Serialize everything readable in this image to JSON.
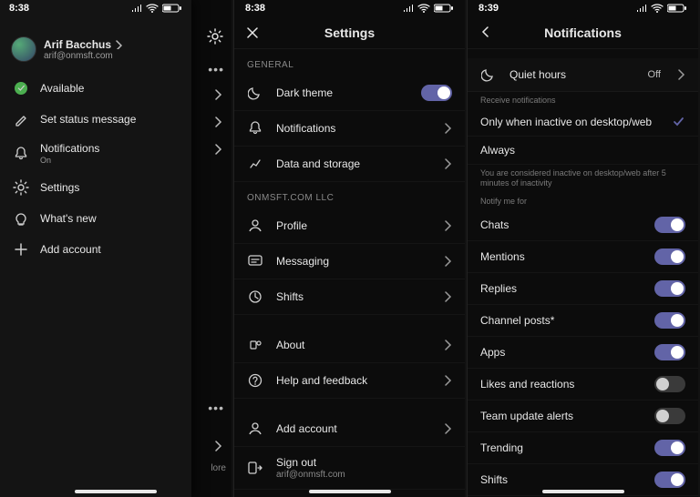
{
  "screen1": {
    "time": "8:38",
    "profile": {
      "name": "Arif Bacchus",
      "email": "arif@onmsft.com"
    },
    "presence": {
      "label": "Available"
    },
    "items": {
      "status": {
        "label": "Set status message"
      },
      "notifications": {
        "label": "Notifications",
        "sub": "On"
      },
      "settings": {
        "label": "Settings"
      },
      "whatsnew": {
        "label": "What's new"
      },
      "add": {
        "label": "Add account"
      }
    },
    "behind_more": "lore"
  },
  "screen2": {
    "time": "8:38",
    "title": "Settings",
    "sections": {
      "general": "GENERAL",
      "org": "ONMSFT.COM LLC"
    },
    "rows": {
      "dark": "Dark theme",
      "notifications": "Notifications",
      "data": "Data and storage",
      "profile": "Profile",
      "messaging": "Messaging",
      "shifts": "Shifts",
      "about": "About",
      "help": "Help and feedback",
      "add": "Add account",
      "signout": {
        "label": "Sign out",
        "sub": "arif@onmsft.com"
      }
    }
  },
  "screen3": {
    "time": "8:39",
    "title": "Notifications",
    "quiet": {
      "label": "Quiet hours",
      "value": "Off"
    },
    "receive_label": "Receive notifications",
    "options": {
      "inactive": "Only when inactive on desktop/web",
      "always": "Always"
    },
    "hint": "You are considered inactive on desktop/web after 5 minutes of inactivity",
    "notify_label": "Notify me for",
    "toggles": {
      "chats": "Chats",
      "mentions": "Mentions",
      "replies": "Replies",
      "channel": "Channel posts*",
      "apps": "Apps",
      "likes": "Likes and reactions",
      "team": "Team update alerts",
      "trending": "Trending",
      "shifts": "Shifts"
    }
  }
}
